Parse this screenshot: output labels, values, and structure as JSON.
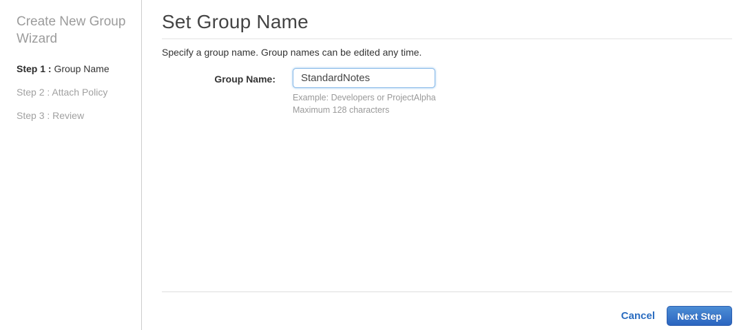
{
  "sidebar": {
    "title": "Create New Group Wizard",
    "steps": [
      {
        "prefix": "Step 1 :",
        "label": "Group Name",
        "active": true
      },
      {
        "prefix": "Step 2 :",
        "label": "Attach Policy",
        "active": false
      },
      {
        "prefix": "Step 3 :",
        "label": "Review",
        "active": false
      }
    ]
  },
  "main": {
    "heading": "Set Group Name",
    "description": "Specify a group name. Group names can be edited any time.",
    "form": {
      "label": "Group Name:",
      "value": "StandardNotes",
      "hint_example": "Example: Developers or ProjectAlpha",
      "hint_max": "Maximum 128 characters"
    },
    "footer": {
      "cancel_label": "Cancel",
      "next_label": "Next Step"
    }
  },
  "colors": {
    "accent_blue": "#2a6cc0",
    "button_gradient_top": "#4c8dd5",
    "button_gradient_bottom": "#2b65c0",
    "input_focus_border": "#85b7e8",
    "inactive_text": "#a0a0a0",
    "divider": "#cccccc"
  }
}
